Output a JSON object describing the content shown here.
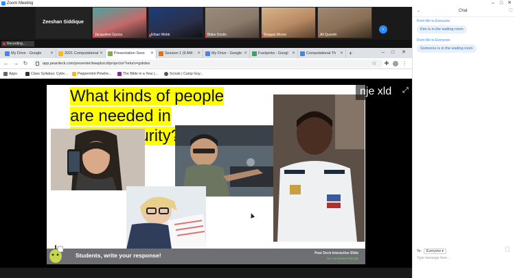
{
  "window": {
    "title": "Zoom Meeting"
  },
  "gallery": {
    "name_tile": "Zeeshan Siddique",
    "participants": [
      {
        "name": "Jacqueline Garcia",
        "color": "#c56a6a"
      },
      {
        "name": "Ethan Webb",
        "color": "#2b2f4a"
      },
      {
        "name": "Blake Doolin",
        "color": "#8b7b6d"
      },
      {
        "name": "Reagan Moore",
        "color": "#b88a64"
      },
      {
        "name": "Ali Qureshi",
        "color": "#8a6f55"
      }
    ]
  },
  "recording": {
    "label": "Recording..."
  },
  "browser": {
    "tabs": [
      {
        "label": "My Drive - Google",
        "color": "#4285f4"
      },
      {
        "label": "2021 Computational",
        "color": "#fbbc05"
      },
      {
        "label": "Presentation Sess",
        "color": "#7cb342"
      },
      {
        "label": "Session 1 (9 AM -",
        "color": "#e8710a"
      },
      {
        "label": "My Drive - Google",
        "color": "#4285f4"
      },
      {
        "label": "Fuelperks - Googl",
        "color": "#34a853"
      },
      {
        "label": "Computational Th",
        "color": "#4285f4"
      }
    ],
    "url": "app.peardeck.com/presenter/twwpbzcd/projector?return=gslides",
    "bookmarks": [
      {
        "label": "Apps",
        "color": "#666666"
      },
      {
        "label": "Class Syllabus: Cybe...",
        "color": "#333333"
      },
      {
        "label": "Peppermint Pinwhe...",
        "color": "#fbbc05"
      },
      {
        "label": "The Bible in a Year (...",
        "color": "#8e24aa"
      },
      {
        "label": "Scouts | Camp Guy...",
        "color": "#555555"
      }
    ]
  },
  "slide": {
    "headline": "What kinds of people are needed in Cybersecurity?",
    "join_code": "nje xld",
    "prompt": "Students, write your response!",
    "badge_title": "Pear Deck Interactive Slide",
    "badge_sub": "Do not remove this bar"
  },
  "chat": {
    "title": "Chat",
    "messages": [
      {
        "meta": "From Me to Everyone:",
        "text": "Kim is in the waiting room"
      },
      {
        "meta": "From Me to Everyone:",
        "text": "Someone is in the waiting room"
      }
    ],
    "to_label": "To:",
    "recipient": "Everyone",
    "input_placeholder": "Type message here..."
  },
  "colors": {
    "zoom_blue": "#2d8cff",
    "pear_banner": "#6d6f72",
    "highlight": "#ffff00"
  }
}
